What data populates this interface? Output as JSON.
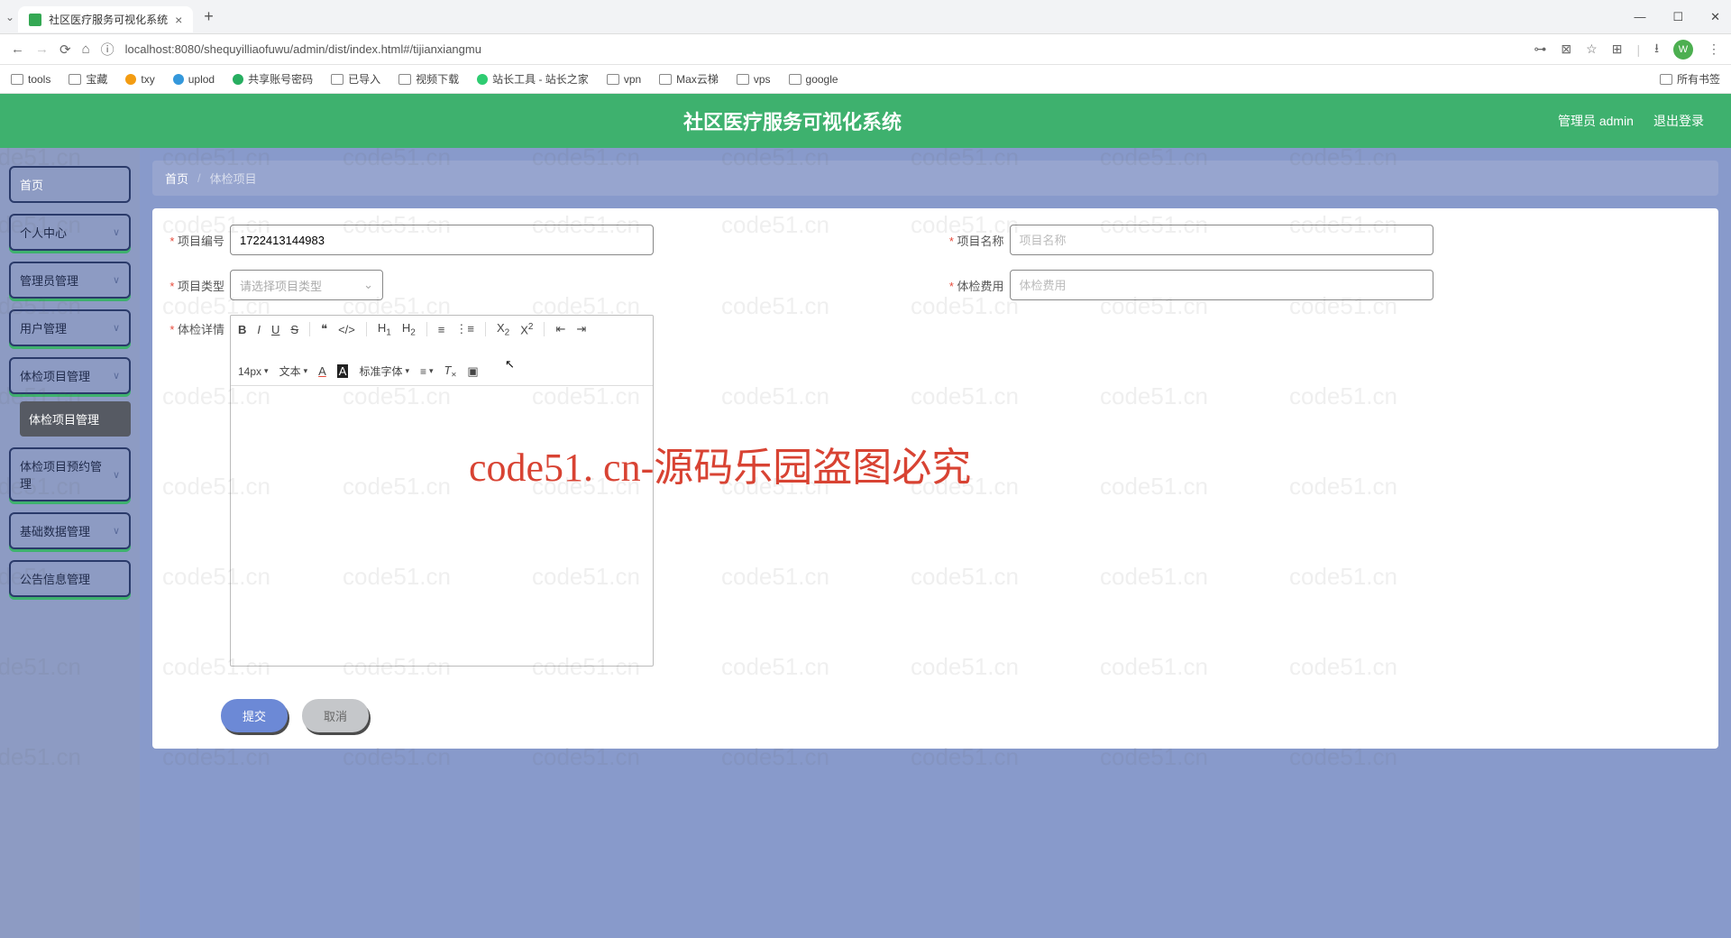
{
  "browser": {
    "tab_title": "社区医疗服务可视化系统",
    "url": "localhost:8080/shequyilliaofuwu/admin/dist/index.html#/tijianxiangmu",
    "bookmarks": [
      "tools",
      "宝藏",
      "txy",
      "uplod",
      "共享账号密码",
      "已导入",
      "视频下载",
      "站长工具 - 站长之家",
      "vpn",
      "Max云梯",
      "vps",
      "google"
    ],
    "bookmarks_right": "所有书签",
    "avatar_letter": "W"
  },
  "header": {
    "title": "社区医疗服务可视化系统",
    "user_label": "管理员 admin",
    "logout": "退出登录"
  },
  "sidebar": {
    "items": [
      {
        "label": "首页",
        "expand": false
      },
      {
        "label": "个人中心",
        "expand": true
      },
      {
        "label": "管理员管理",
        "expand": true
      },
      {
        "label": "用户管理",
        "expand": true
      },
      {
        "label": "体检项目管理",
        "expand": true
      },
      {
        "label": "体检项目预约管理",
        "expand": true
      },
      {
        "label": "基础数据管理",
        "expand": true
      },
      {
        "label": "公告信息管理",
        "expand": false
      }
    ],
    "sub_active": "体检项目管理"
  },
  "breadcrumb": {
    "home": "首页",
    "current": "体检项目"
  },
  "form": {
    "proj_no_label": "项目编号",
    "proj_no_value": "1722413144983",
    "proj_name_label": "项目名称",
    "proj_name_placeholder": "项目名称",
    "proj_type_label": "项目类型",
    "proj_type_placeholder": "请选择项目类型",
    "fee_label": "体检费用",
    "fee_placeholder": "体检费用",
    "detail_label": "体检详情"
  },
  "editor": {
    "font_size": "14px",
    "text_label": "文本",
    "font_family": "标准字体"
  },
  "buttons": {
    "submit": "提交",
    "cancel": "取消"
  },
  "watermark": "code51.cn",
  "big_watermark": "code51. cn-源码乐园盗图必究"
}
